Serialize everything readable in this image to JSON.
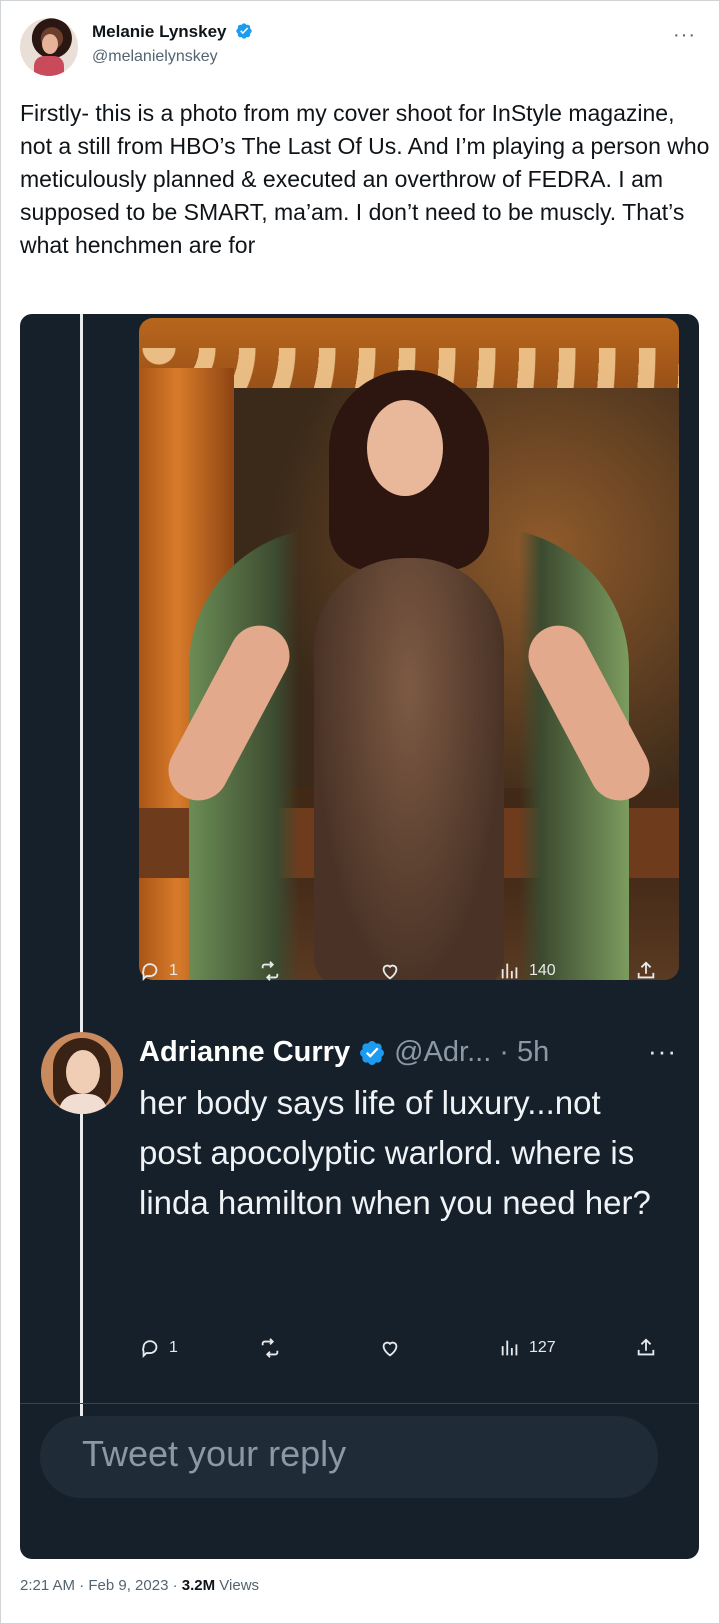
{
  "author": {
    "name": "Melanie Lynskey",
    "handle": "@melanielynskey",
    "more": "···"
  },
  "tweet": {
    "text": "Firstly- this is a photo from my cover shoot for InStyle magazine, not a still from HBO’s The Last Of Us. And I’m playing a person who meticulously planned & executed an overthrow of FEDRA. I am supposed to be SMART, ma’am. I don’t need to be muscly. That’s what henchmen are for"
  },
  "quoted": {
    "photo_actions": {
      "replies": "1",
      "views": "140"
    },
    "reply": {
      "name": "Adrianne Curry",
      "handle": "@Adr... · 5h",
      "more": "···",
      "text": "her body says life of luxury...not post apocolyptic warlord. where is linda hamilton when you need her?",
      "replies": "1",
      "views": "127"
    },
    "reply_box": {
      "placeholder": "Tweet your reply"
    }
  },
  "meta": {
    "time": "2:21 AM · Feb 9, 2023 · ",
    "views_count": "3.2M",
    "views_label": " Views"
  },
  "colors": {
    "dark_bg": "#15202b",
    "verified_blue": "#1d9bf0",
    "muted": "#536471"
  },
  "icons": [
    "reply-icon",
    "retweet-icon",
    "like-icon",
    "views-icon",
    "share-icon",
    "verified-icon"
  ]
}
